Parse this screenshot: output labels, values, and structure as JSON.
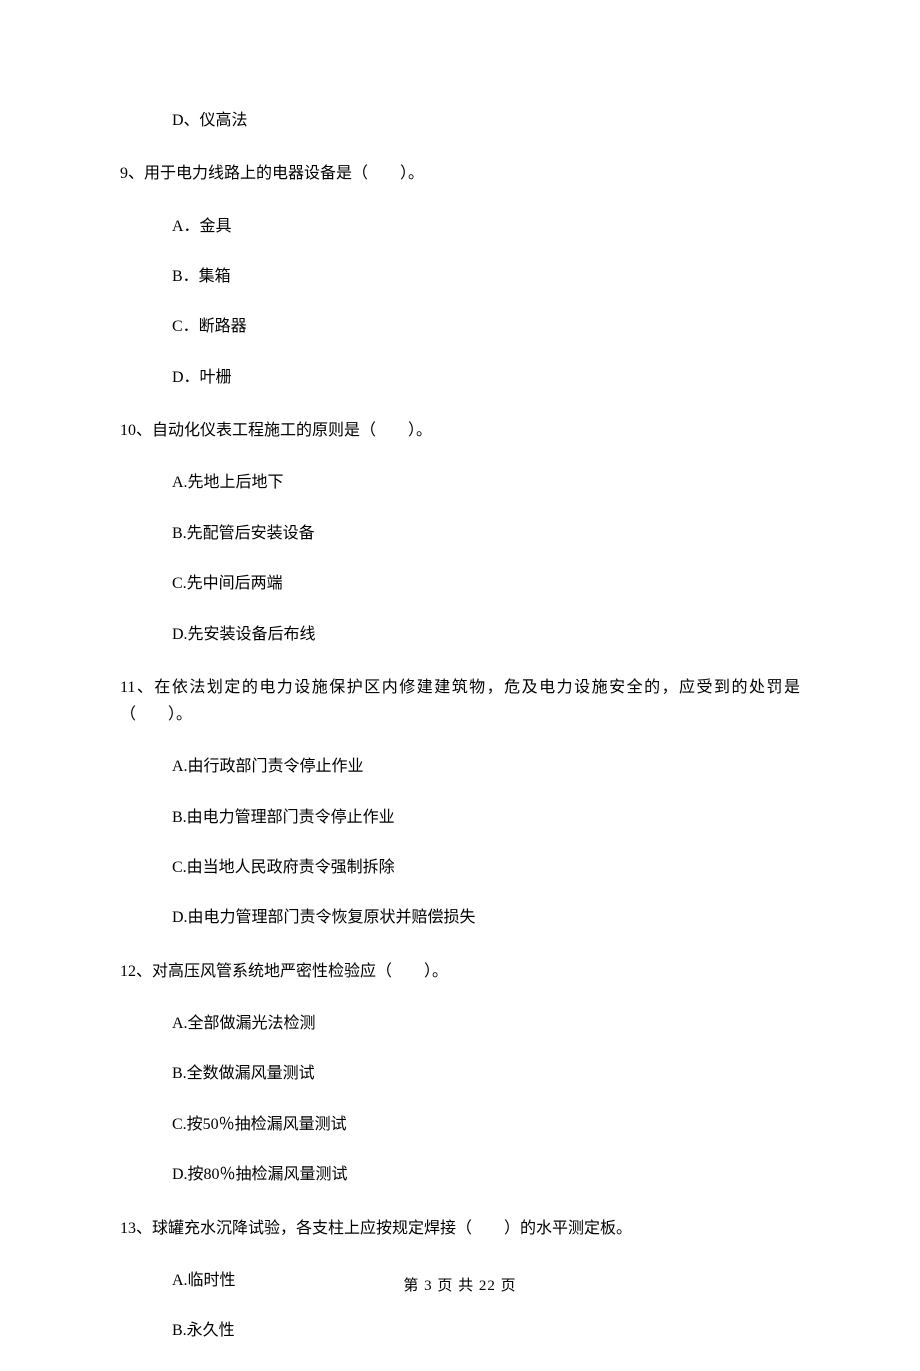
{
  "q8": {
    "optD": "D、仪高法"
  },
  "q9": {
    "stem": "9、用于电力线路上的电器设备是（　　）。",
    "optA": "A．金具",
    "optB": "B．集箱",
    "optC": "C．断路器",
    "optD": "D．叶栅"
  },
  "q10": {
    "stem": "10、自动化仪表工程施工的原则是（　　）。",
    "optA": "A.先地上后地下",
    "optB": "B.先配管后安装设备",
    "optC": "C.先中间后两端",
    "optD": "D.先安装设备后布线"
  },
  "q11": {
    "stem": "11、在依法划定的电力设施保护区内修建建筑物，危及电力设施安全的，应受到的处罚是（　　）。",
    "optA": "A.由行政部门责令停止作业",
    "optB": "B.由电力管理部门责令停止作业",
    "optC": "C.由当地人民政府责令强制拆除",
    "optD": "D.由电力管理部门责令恢复原状并赔偿损失"
  },
  "q12": {
    "stem": "12、对高压风管系统地严密性检验应（　　）。",
    "optA": "A.全部做漏光法检测",
    "optB": "B.全数做漏风量测试",
    "optC": "C.按50％抽检漏风量测试",
    "optD": "D.按80％抽检漏风量测试"
  },
  "q13": {
    "stem": "13、球罐充水沉降试验，各支柱上应按规定焊接（　　）的水平测定板。",
    "optA": "A.临时性",
    "optB": "B.永久性"
  },
  "footer": "第 3 页 共 22 页"
}
